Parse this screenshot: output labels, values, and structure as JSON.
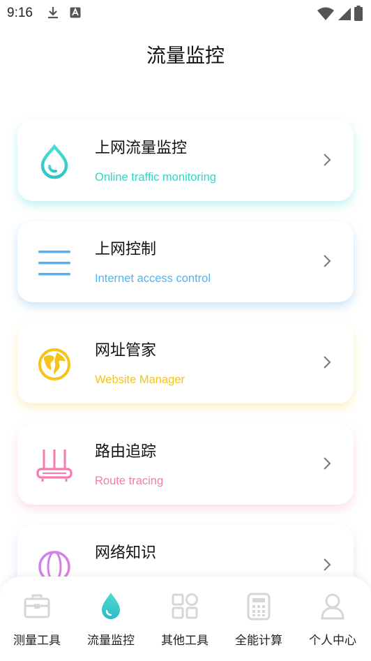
{
  "status_bar": {
    "time": "9:16"
  },
  "page": {
    "title": "流量监控"
  },
  "cards": [
    {
      "title": "上网流量监控",
      "subtitle": "Online traffic monitoring",
      "color": "#36D3C6",
      "icon": "water-drop-icon"
    },
    {
      "title": "上网控制",
      "subtitle": "Internet access control",
      "color": "#4FB4F2",
      "icon": "menu-lines-icon"
    },
    {
      "title": "网址管家",
      "subtitle": "Website Manager",
      "color": "#F2C41C",
      "icon": "globe-americas-icon"
    },
    {
      "title": "路由追踪",
      "subtitle": "Route tracing",
      "color": "#F57AAE",
      "icon": "router-icon"
    },
    {
      "title": "网络知识",
      "subtitle": "",
      "color": "#C486F0",
      "icon": "globe-grid-icon"
    }
  ],
  "bottom_nav": {
    "items": [
      {
        "label": "测量工具",
        "icon": "toolbox-icon",
        "active": false
      },
      {
        "label": "流量监控",
        "icon": "water-drop-icon",
        "active": true
      },
      {
        "label": "其他工具",
        "icon": "grid-apps-icon",
        "active": false
      },
      {
        "label": "全能计算",
        "icon": "calculator-icon",
        "active": false
      },
      {
        "label": "个人中心",
        "icon": "person-icon",
        "active": false
      }
    ],
    "active_color": "#36D3C6",
    "inactive_color": "#D6D6D6"
  }
}
